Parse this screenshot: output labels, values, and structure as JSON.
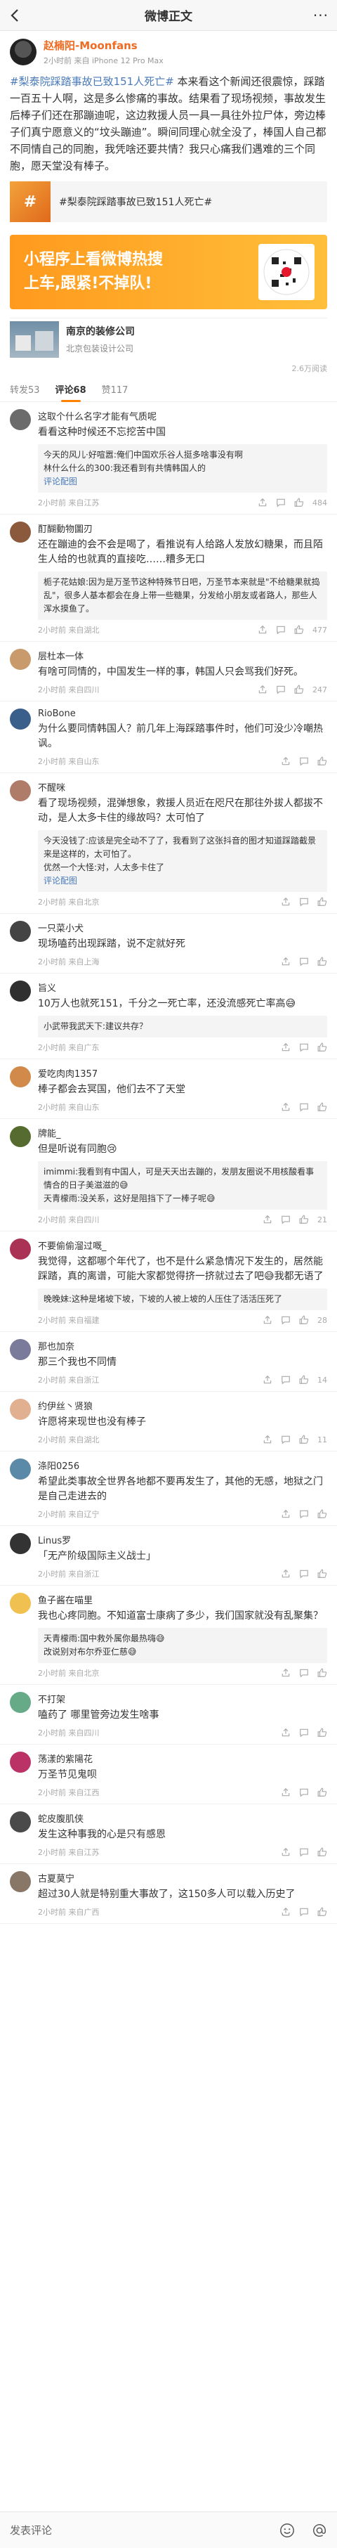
{
  "header": {
    "title": "微博正文",
    "more": "···"
  },
  "post": {
    "author": "赵楠阳-Moonfans",
    "meta": "2小时前  来自 iPhone 12 Pro Max",
    "topic": "#梨泰院踩踏事故已致151人死亡#",
    "text": " 本来看这个新闻还很震惊，踩踏一百五十人啊，这是多么惨痛的事故。结果看了现场视频，事故发生后棒子们还在那蹦迪呢，这边救援人员一具一具往外拉尸体，旁边棒子们真宁愿意义的“坟头蹦迪”。瞬间同理心就全没了，棒国人自己都不同情自己的同胞，我凭啥还要共情？我只心痛我们遇难的三个同胞，愿天堂没有棒子。",
    "card_text": "#梨泰院踩踏事故已致151人死亡#",
    "card_icon": "#"
  },
  "banner": {
    "line1": "小程序上看微博热搜",
    "line2": "上车,跟紧!不掉队!"
  },
  "repost_card": {
    "title": "南京的装修公司",
    "subtitle": "北京包装设计公司"
  },
  "views": "2.6万阅读",
  "tabs": [
    {
      "label": "转发53"
    },
    {
      "label": "评论68"
    },
    {
      "label": "赞117"
    }
  ],
  "comments": [
    {
      "name": "这取个什么名字才能有气质呢",
      "text": "看看这种时候还不忘挖苦中国",
      "time": "2小时前  来自江苏",
      "likes": "484",
      "reply": "今天的风儿·好喧嚣:俺们中国欢乐谷人挺多啥事没有啊",
      "reply2": "林什么什么的300:我还看到有共情韩国人的",
      "more": "评论配图"
    },
    {
      "name": "酊醐動物圖刃",
      "text": "还在蹦迪的会不会是喝了，看推说有人给路人发放幻糖果，而且陌生人给的也就真的直接吃……糟多无口",
      "time": "2小时前  来自湖北",
      "likes": "477",
      "reply": "栀子花姑娘:因为是万圣节这种特殊节日吧，万圣节本来就是\"不给糖果就捣乱\"，很多人基本都会在身上带一些糖果，分发给小朋友或者路人，那些人浑水摸鱼了。",
      "reply2": "",
      "more": ""
    },
    {
      "name": "层杜本一体",
      "text": "有啥可同情的，中国发生一样的事，韩国人只会骂我们好死。",
      "time": "2小时前  来自四川",
      "likes": "247"
    },
    {
      "name": "RioBone",
      "text": "为什么要同情韩国人？前几年上海踩踏事件时，他们可没少冷嘲热讽。",
      "time": "2小时前  来自山东",
      "likes": ""
    },
    {
      "name": "不醒咪",
      "text": "看了现场视频，混弹想象，救援人员近在咫尺在那往外拔人都拔不动，是人太多卡住的缘故吗？太可怕了",
      "time": "2小时前  来自北京",
      "likes": "",
      "reply": "今天没钱了:应该是完全动不了了，我看到了这张抖音的图才知道踩踏截景来是这样的，太可怕了。",
      "reply2": "优然一个大怪:对，人太多卡住了",
      "more": "评论配图"
    },
    {
      "name": "一只菜小犬",
      "text": "现场嗑药出现踩踏，说不定就好死",
      "time": "2小时前  来自上海",
      "likes": ""
    },
    {
      "name": "旨义",
      "text": "10万人也就死151，千分之一死亡率，还没流感死亡率高😅",
      "time": "2小时前  来自广东",
      "likes": "",
      "reply": "小武带我武天下:建议共存？",
      "reply2": "",
      "more": ""
    },
    {
      "name": "爱吃肉肉1357",
      "text": "棒子都会去冥国，他们去不了天堂",
      "time": "2小时前  来自山东",
      "likes": ""
    },
    {
      "name": "牌能_",
      "text": "但是听说有同胞😢",
      "time": "2小时前  来自四川",
      "likes": "21",
      "reply": "imimmi:我看到有中国人，可是天天出去蹦的，发朋友圈说不用核酸看事情合的日子美滋滋的😅",
      "reply2": "天青檬雨:没关系，这好是阻挡下了一棒子呢😅",
      "more": ""
    },
    {
      "name": "不要偷偷溜过嘅_",
      "text": "我觉得，这都哪个年代了，也不是什么紧急情况下发生的，居然能踩踏，真的离谱，可能大家都觉得挤一挤就过去了吧😅我都无语了",
      "time": "2小时前  来自福建",
      "likes": "28",
      "reply": "晚晚妹:这种是堵坡下坡，下坡的人被上坡的人压住了活活压死了",
      "reply2": "",
      "more": ""
    },
    {
      "name": "那也加奈",
      "text": "那三个我也不同情",
      "time": "2小时前  来自浙江",
      "likes": "14"
    },
    {
      "name": "约伊丝丶贤狼",
      "text": "许愿将来现世也没有棒子",
      "time": "2小时前  来自湖北",
      "likes": "11"
    },
    {
      "name": "涤阳0256",
      "text": "希望此类事故全世界各地都不要再发生了，其他的无感，地狱之门是自己走进去的",
      "time": "2小时前  来自辽宁",
      "likes": ""
    },
    {
      "name": "Linus罗",
      "text": "「无产阶级国际主义战士」",
      "time": "2小时前  来自浙江",
      "likes": ""
    },
    {
      "name": "鱼子酱在喵里",
      "text": "我也心疼同胞。不知道富士康病了多少，我们国家就没有乱聚集？",
      "time": "2小时前  来自北京",
      "likes": "",
      "reply": "天青檬雨:国中救外属你最热嗨😅",
      "reply2": "改说别对布尔乔亚仁慈😅",
      "more": ""
    },
    {
      "name": "不打架",
      "text": "嗑药了 哪里管旁边发生啥事",
      "time": "2小时前  来自四川",
      "likes": ""
    },
    {
      "name": "荡漾的紫陽花",
      "text": "万圣节见鬼呗",
      "time": "2小时前  来自江西",
      "likes": ""
    },
    {
      "name": "蛇皮腹肌侠",
      "text": "发生这种事我的心是只有感恩",
      "time": "2小时前  来自江苏",
      "likes": ""
    },
    {
      "name": "古夏莫宁",
      "text": "超过30人就是特别重大事故了，这150多人可以载入历史了",
      "time": "2小时前  来自广西",
      "likes": ""
    }
  ],
  "bottombar": {
    "input": "发表评论"
  },
  "colors": {
    "accent": "#ff8200",
    "link": "#4a7ab8",
    "username": "#f06b22"
  }
}
